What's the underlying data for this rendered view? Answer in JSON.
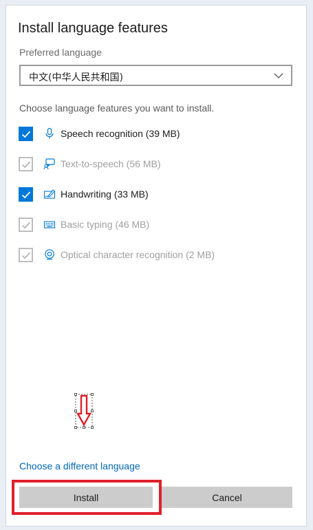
{
  "dialog": {
    "title": "Install language features",
    "preferred_label": "Preferred language",
    "preferred_value": "中文(中华人民共和国)",
    "choose_text": "Choose language features you want to install.",
    "features": [
      {
        "label": "Speech recognition (39 MB)",
        "icon": "microphone-icon",
        "checked": true,
        "enabled": true
      },
      {
        "label": "Text-to-speech (56 MB)",
        "icon": "speech-bubble-icon",
        "checked": true,
        "enabled": false
      },
      {
        "label": "Handwriting (33 MB)",
        "icon": "pen-icon",
        "checked": true,
        "enabled": true
      },
      {
        "label": "Basic typing (46 MB)",
        "icon": "keyboard-icon",
        "checked": true,
        "enabled": false
      },
      {
        "label": "Optical character recognition (2 MB)",
        "icon": "ocr-icon",
        "checked": true,
        "enabled": false
      }
    ],
    "change_language_link": "Choose a different language",
    "install_label": "Install",
    "cancel_label": "Cancel"
  },
  "colors": {
    "accent": "#0078d7",
    "link": "#0067b8",
    "highlight": "#e0202a",
    "button_bg": "#cccccc"
  }
}
